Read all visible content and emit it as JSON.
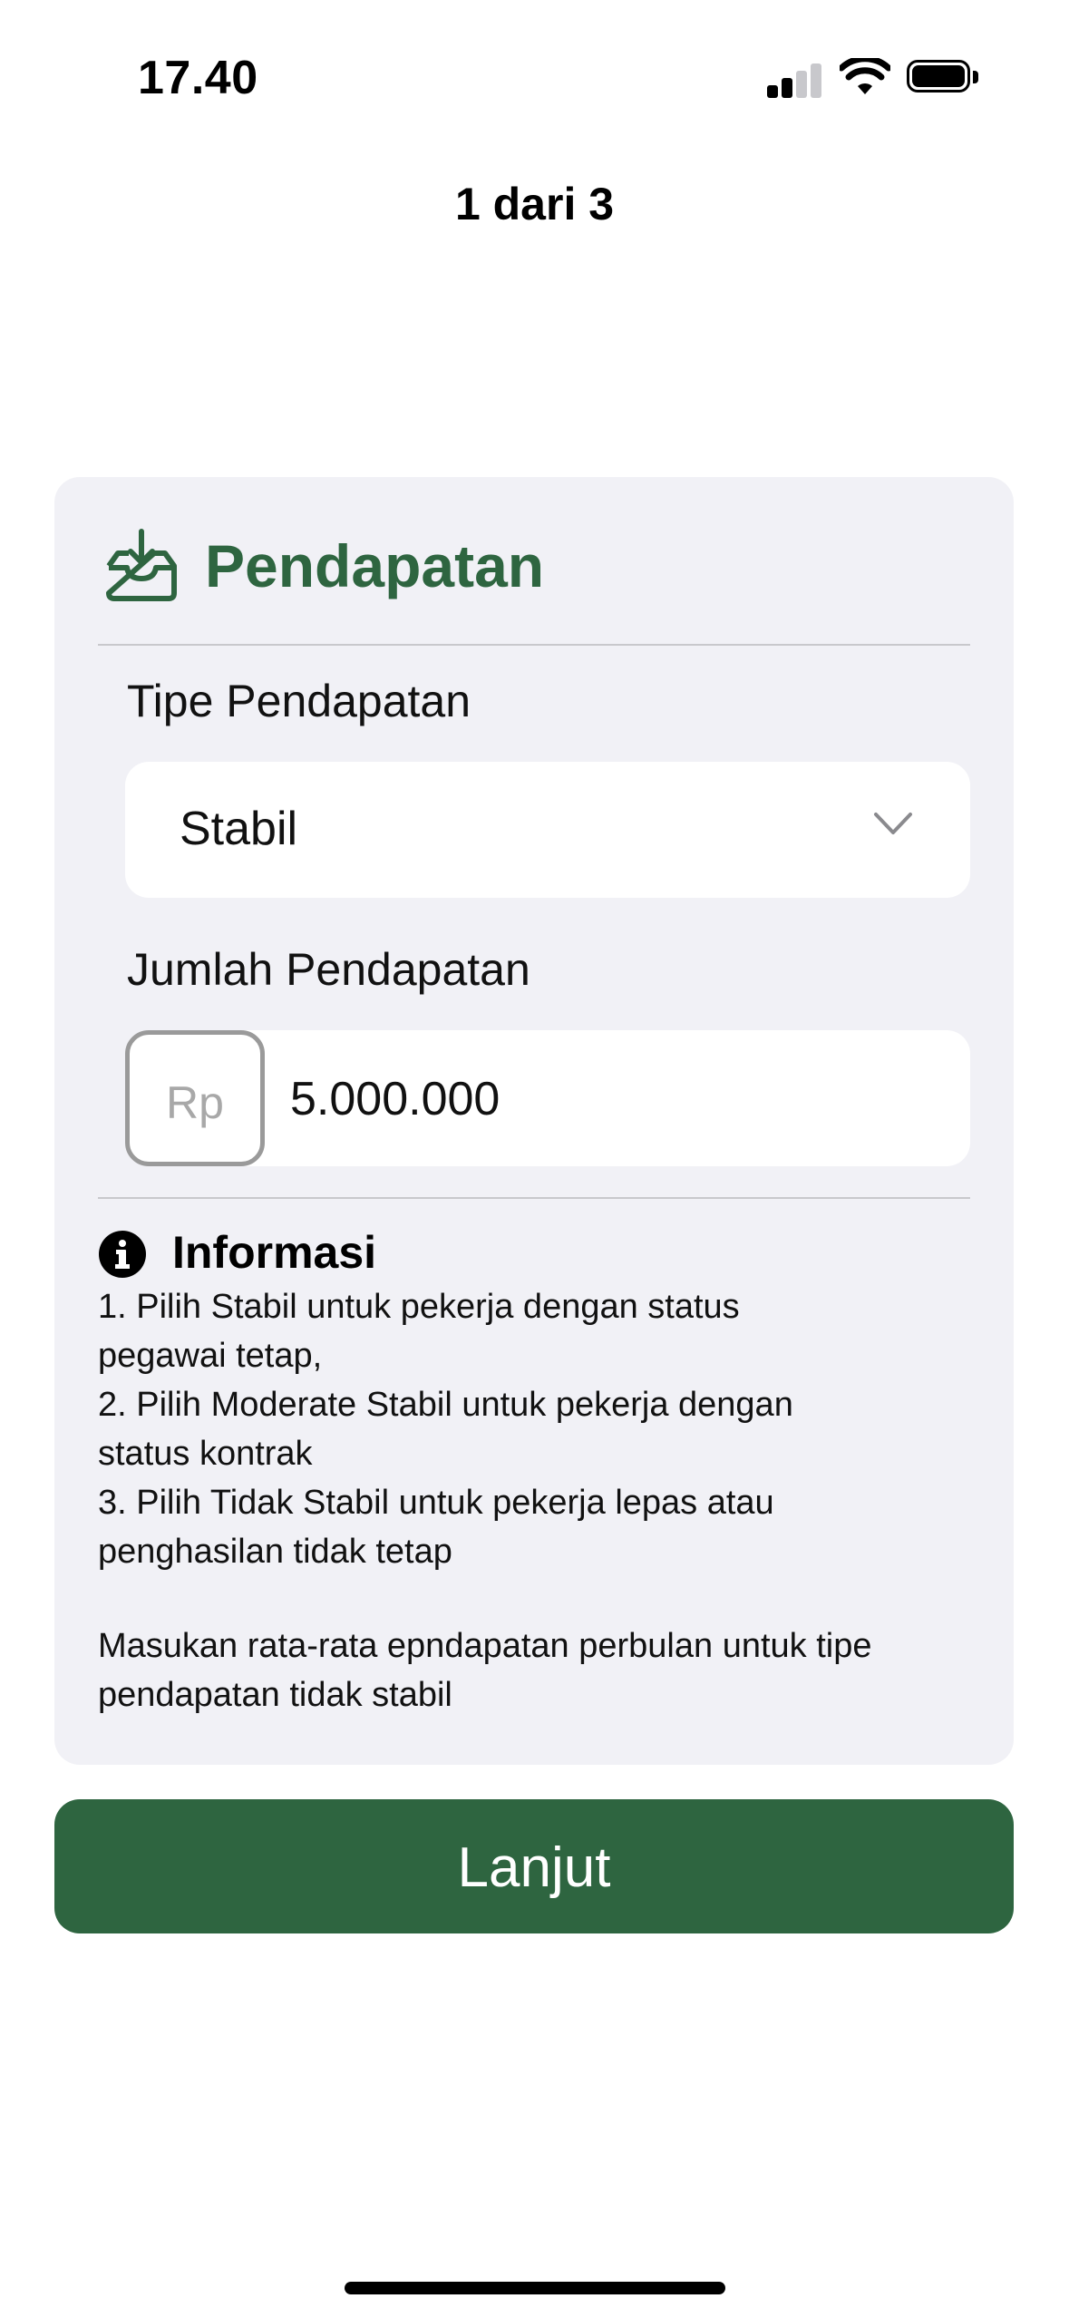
{
  "status_bar": {
    "time": "17.40",
    "signal_icon": "cellular-signal-icon",
    "wifi_icon": "wifi-icon",
    "battery_icon": "battery-icon"
  },
  "header": {
    "step_indicator": "1 dari 3"
  },
  "card": {
    "icon": "inbox-download-icon",
    "title": "Pendapatan",
    "accent_color": "#2e6540",
    "income_type": {
      "label": "Tipe Pendapatan",
      "selected": "Stabil"
    },
    "income_amount": {
      "label": "Jumlah Pendapatan",
      "currency": "Rp",
      "value": "5.000.000"
    },
    "info": {
      "icon": "info-icon",
      "title": "Informasi",
      "lines": [
        "1. Pilih Stabil untuk pekerja dengan status",
        "pegawai tetap,",
        "2. Pilih Moderate Stabil untuk pekerja dengan",
        "status kontrak",
        "3. Pilih Tidak Stabil untuk pekerja lepas atau",
        "penghasilan tidak tetap"
      ],
      "note_lines": [
        "Masukan rata-rata epndapatan perbulan untuk tipe",
        "pendapatan tidak stabil"
      ]
    }
  },
  "actions": {
    "next_label": "Lanjut"
  }
}
